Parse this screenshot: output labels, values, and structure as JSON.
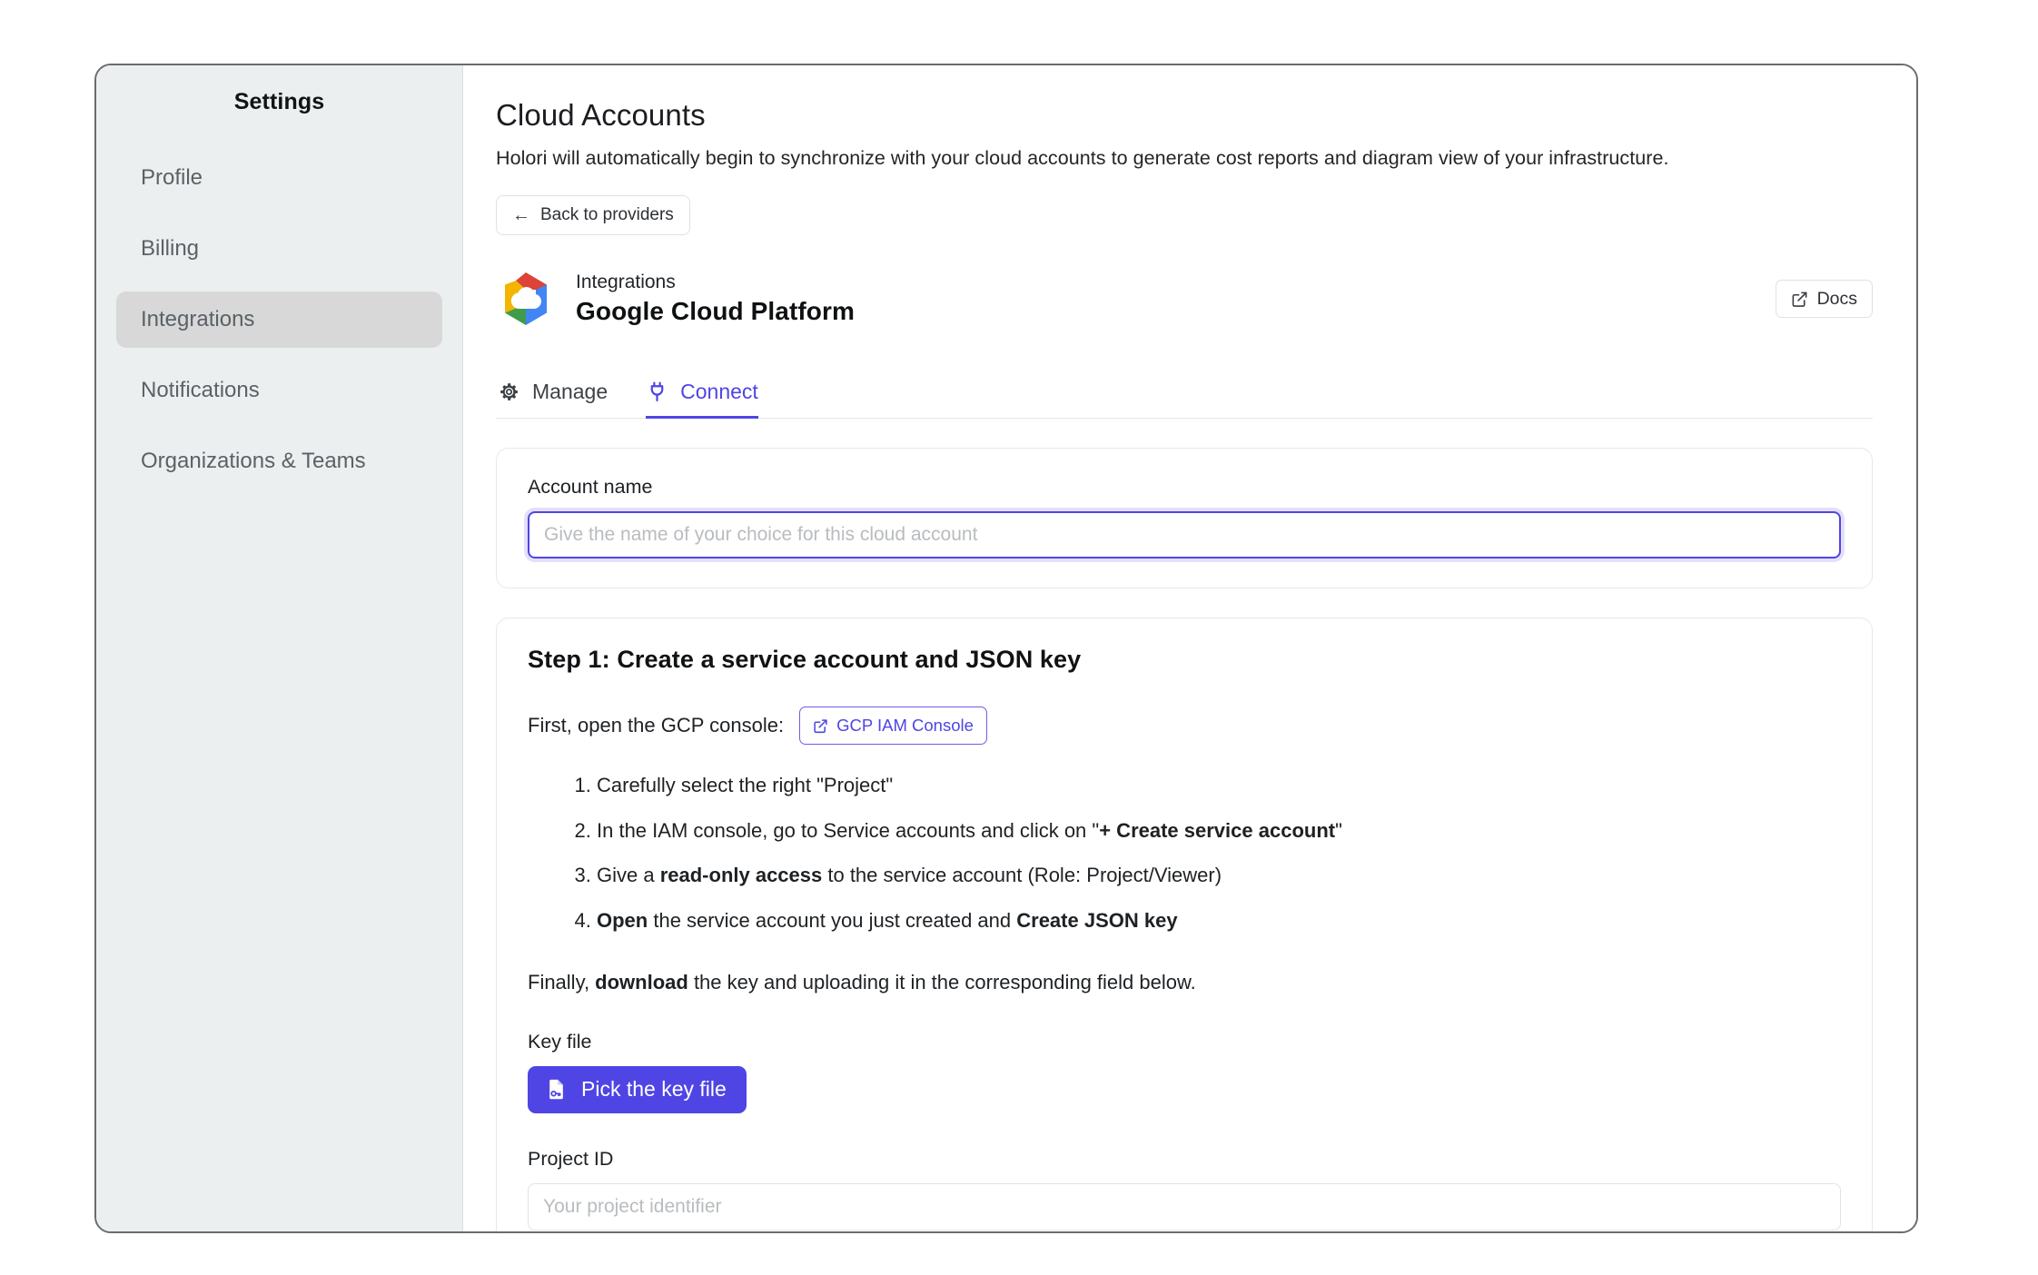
{
  "sidebar": {
    "title": "Settings",
    "items": [
      {
        "label": "Profile",
        "active": false
      },
      {
        "label": "Billing",
        "active": false
      },
      {
        "label": "Integrations",
        "active": true
      },
      {
        "label": "Notifications",
        "active": false
      },
      {
        "label": "Organizations & Teams",
        "active": false
      }
    ]
  },
  "main": {
    "page_title": "Cloud Accounts",
    "page_subtitle": "Holori will automatically begin to synchronize with your cloud accounts to generate cost reports and diagram view of your infrastructure.",
    "back_button": "Back to providers",
    "back_arrow": "←",
    "provider": {
      "kicker": "Integrations",
      "name": "Google Cloud Platform",
      "logo_icon": "google-cloud-logo",
      "colors": {
        "red": "#db4437",
        "blue": "#4285f4",
        "yellow": "#f4b400",
        "green": "#3f9c49",
        "white": "#ffffff"
      }
    },
    "docs_button": "Docs",
    "tabs": [
      {
        "label": "Manage",
        "icon": "gear-icon",
        "active": false
      },
      {
        "label": "Connect",
        "icon": "plug-icon",
        "active": true
      }
    ],
    "account_card": {
      "label": "Account name",
      "placeholder": "Give the name of your choice for this cloud account",
      "value": "",
      "focused": true
    },
    "step_card": {
      "title": "Step 1: Create a service account and JSON key",
      "console_prefix": "First, open the GCP console:",
      "console_button": "GCP IAM Console",
      "steps": [
        {
          "parts": [
            {
              "t": "Carefully select the right \"Project\"",
              "b": false
            }
          ]
        },
        {
          "parts": [
            {
              "t": "In the IAM console, go to Service accounts and click on \"",
              "b": false
            },
            {
              "t": "+ Create service account",
              "b": true
            },
            {
              "t": "\"",
              "b": false
            }
          ]
        },
        {
          "parts": [
            {
              "t": "Give a ",
              "b": false
            },
            {
              "t": "read-only access",
              "b": true
            },
            {
              "t": " to the service account (Role: Project/Viewer)",
              "b": false
            }
          ]
        },
        {
          "parts": [
            {
              "t": "Open",
              "b": true
            },
            {
              "t": " the service account you just created and ",
              "b": false
            },
            {
              "t": "Create JSON key",
              "b": true
            }
          ]
        }
      ],
      "finally_parts": [
        {
          "t": "Finally, ",
          "b": false
        },
        {
          "t": "download",
          "b": true
        },
        {
          "t": " the key and uploading it in the corresponding field below.",
          "b": false
        }
      ],
      "keyfile_label": "Key file",
      "pick_button": "Pick the key file",
      "pick_button_icon": "file-key-icon",
      "projectid_label": "Project ID",
      "projectid_placeholder": "Your project identifier",
      "projectid_value": ""
    }
  },
  "theme": {
    "accent": "#4f45e4",
    "sidebar_bg": "#eceff0",
    "active_item_bg": "#d8d8d8"
  }
}
